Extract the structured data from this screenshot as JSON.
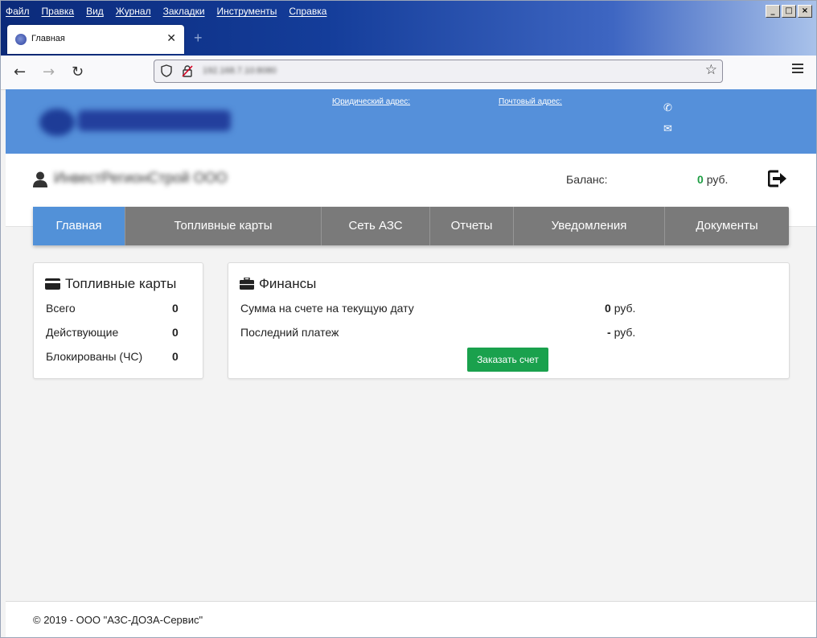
{
  "browser": {
    "menu": [
      "Файл",
      "Правка",
      "Вид",
      "Журнал",
      "Закладки",
      "Инструменты",
      "Справка"
    ],
    "tab_title": "Главная",
    "tab_close": "✕",
    "new_tab": "+",
    "url": "192.168.7.10:8080"
  },
  "header": {
    "legal_address_link": "Юридический адрес:",
    "postal_address_link": "Почтовый адрес:"
  },
  "user": {
    "name": "ИнвестРегионСтрой ООО",
    "balance_label": "Баланс:",
    "balance_value": "0",
    "balance_currency": "руб."
  },
  "nav": {
    "items": [
      "Главная",
      "Топливные карты",
      "Сеть АЗС",
      "Отчеты",
      "Уведомления",
      "Документы"
    ],
    "active": "Главная"
  },
  "fuel_cards": {
    "title": "Топливные карты",
    "rows": [
      {
        "label": "Всего",
        "value": "0"
      },
      {
        "label": "Действующие",
        "value": "0"
      },
      {
        "label": "Блокированы (ЧС)",
        "value": "0"
      }
    ]
  },
  "finance": {
    "title": "Финансы",
    "rows": [
      {
        "label": "Сумма на счете на текущую дату",
        "value": "0",
        "currency": "руб."
      },
      {
        "label": "Последний платеж",
        "value": "-",
        "currency": "руб."
      }
    ],
    "order_button": "Заказать счет"
  },
  "footer": {
    "text": "© 2019 - ООО \"АЗС-ДОЗА-Сервис\""
  },
  "colors": {
    "header_blue": "#5590da",
    "nav_gray": "#7a7a7a",
    "nav_active": "#5291d8",
    "balance_green": "#1f9e44",
    "button_green": "#1aa14d"
  }
}
